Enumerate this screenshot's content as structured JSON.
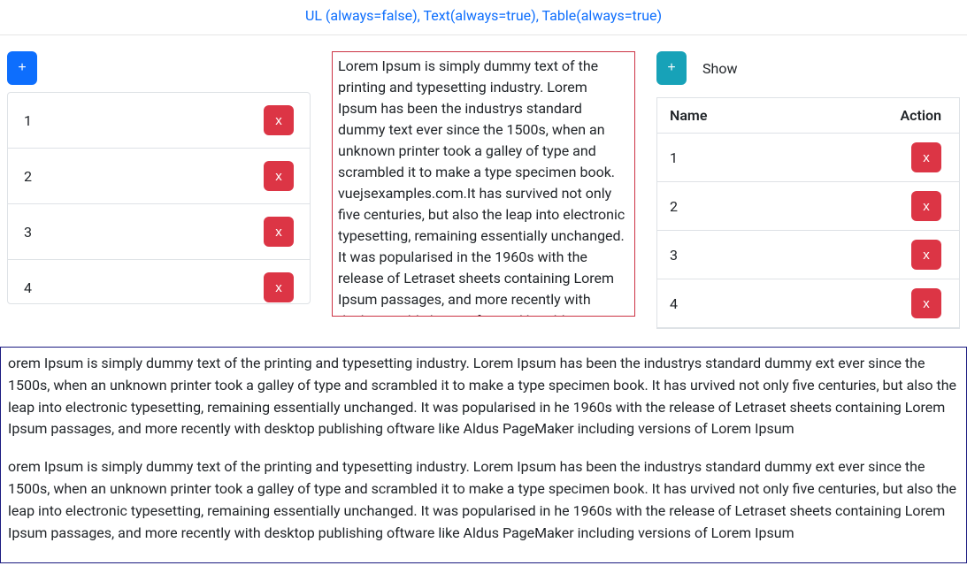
{
  "header": {
    "title": "UL (always=false), Text(always=true), Table(always=true)"
  },
  "list": {
    "add_label": "+",
    "items": [
      {
        "label": "1",
        "remove": "x"
      },
      {
        "label": "2",
        "remove": "x"
      },
      {
        "label": "3",
        "remove": "x"
      },
      {
        "label": "4",
        "remove": "x"
      }
    ]
  },
  "text_panel": {
    "content": "Lorem Ipsum is simply dummy text of the printing and typesetting industry. Lorem Ipsum has been the industrys standard dummy text ever since the 1500s, when an unknown printer took a galley of type and scrambled it to make a type specimen book. vuejsexamples.com.It has survived not only five centuries, but also the leap into electronic typesetting, remaining essentially unchanged. It was popularised in the 1960s with the release of Letraset sheets containing Lorem Ipsum passages, and more recently with desktop publishing software like Aldus PageMaker including versions of Lorem Ipsum"
  },
  "table": {
    "add_label": "+",
    "show_label": "Show",
    "headers": {
      "name": "Name",
      "action": "Action"
    },
    "rows": [
      {
        "name": "1",
        "remove": "x"
      },
      {
        "name": "2",
        "remove": "x"
      },
      {
        "name": "3",
        "remove": "x"
      },
      {
        "name": "4",
        "remove": "x"
      }
    ]
  },
  "bottom": {
    "p1": "orem Ipsum is simply dummy text of the printing and typesetting industry. Lorem Ipsum has been the industrys standard dummy ext ever since the 1500s, when an unknown printer took a galley of type and scrambled it to make a type specimen book. It has urvived not only five centuries, but also the leap into electronic typesetting, remaining essentially unchanged. It was popularised in he 1960s with the release of Letraset sheets containing Lorem Ipsum passages, and more recently with desktop publishing oftware like Aldus PageMaker including versions of Lorem Ipsum",
    "p2": "orem Ipsum is simply dummy text of the printing and typesetting industry. Lorem Ipsum has been the industrys standard dummy ext ever since the 1500s, when an unknown printer took a galley of type and scrambled it to make a type specimen book. It has urvived not only five centuries, but also the leap into electronic typesetting, remaining essentially unchanged. It was popularised in he 1960s with the release of Letraset sheets containing Lorem Ipsum passages, and more recently with desktop publishing oftware like Aldus PageMaker including versions of Lorem Ipsum"
  }
}
